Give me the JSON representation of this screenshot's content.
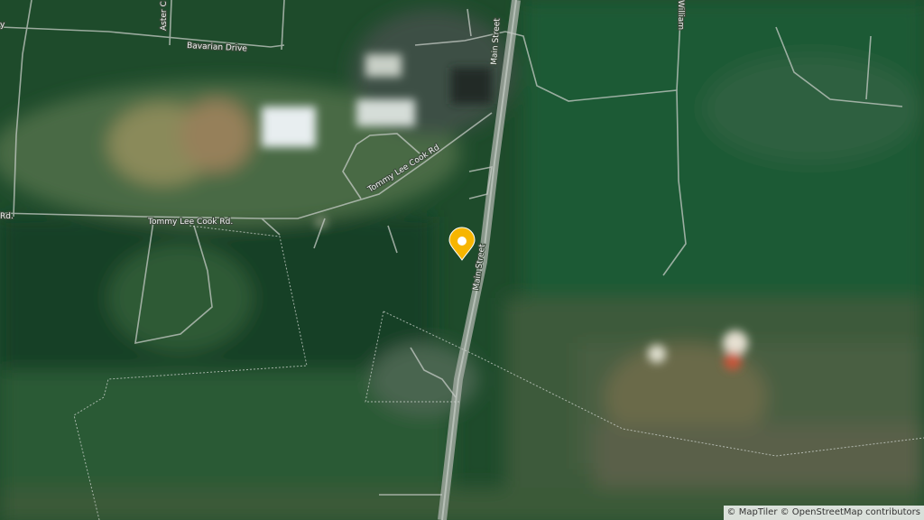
{
  "map": {
    "type": "satellite",
    "roads": {
      "aster": "Aster C",
      "bavarian": "Bavarian Drive",
      "tommy_upper": "Tommy Lee Cook Rd",
      "tommy_lower": "Tommy Lee Cook Rd.",
      "rd_left": "Rd.",
      "main_upper": "Main Street",
      "main_lower": "Main Street",
      "william": "William",
      "partial_left": "y"
    },
    "marker": {
      "icon": "map-pin-icon",
      "color": "#f7b500"
    },
    "attribution": {
      "maptiler": "© MapTiler",
      "osm": "© OpenStreetMap contributors"
    }
  }
}
